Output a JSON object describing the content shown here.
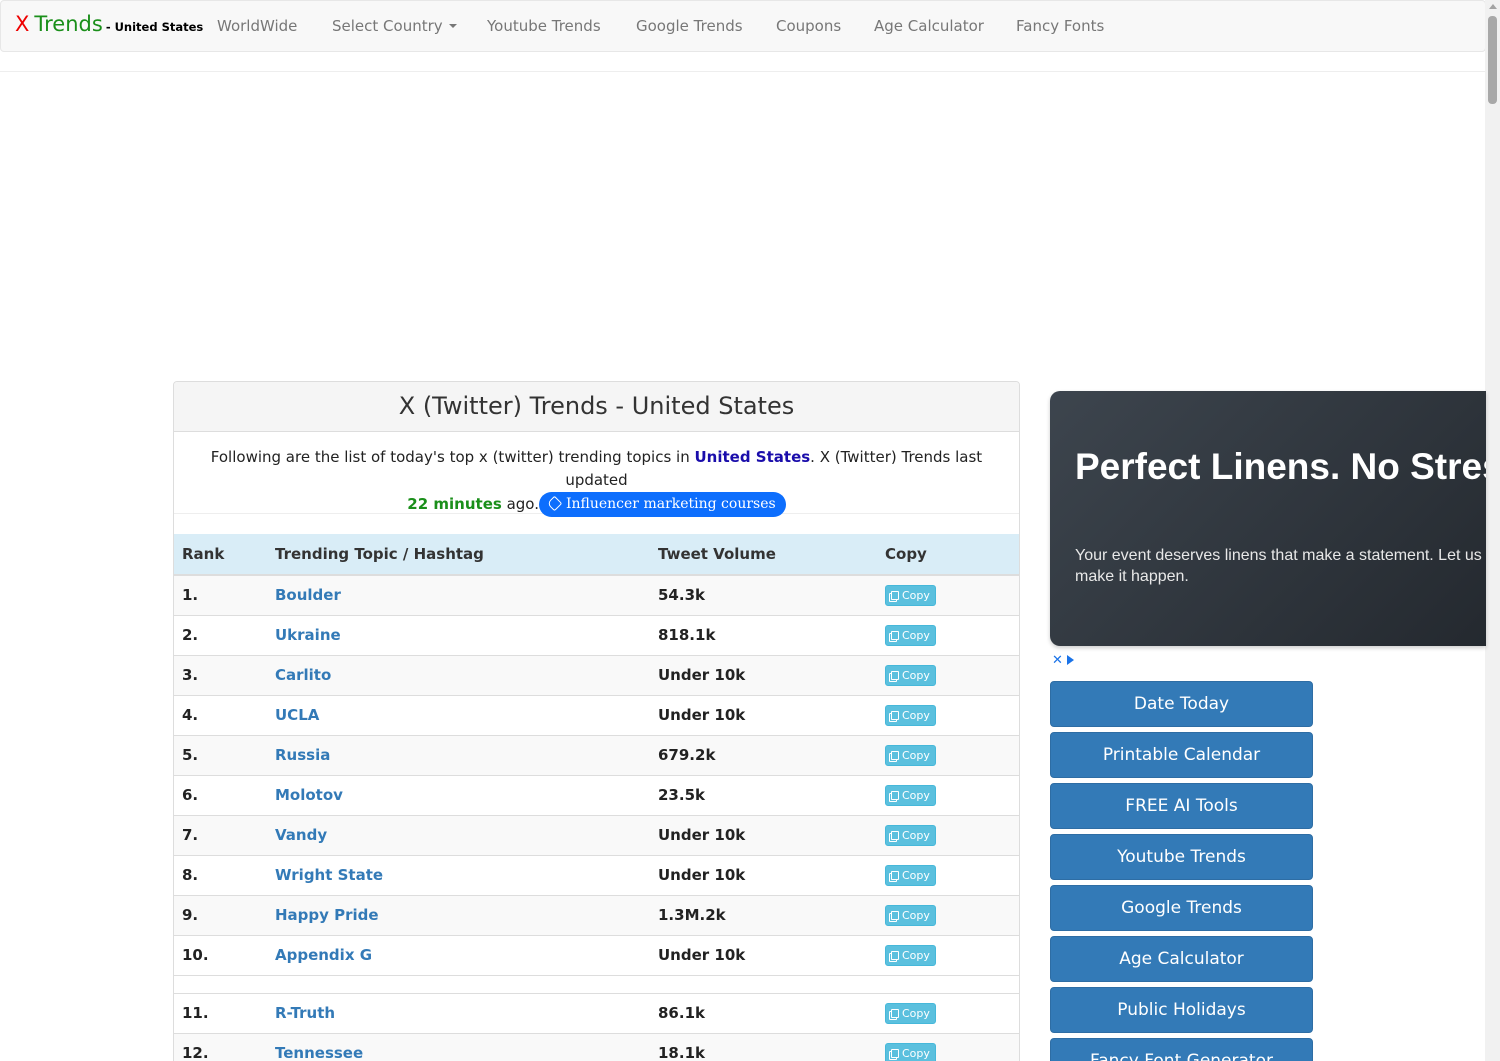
{
  "navbar": {
    "brand_x": "X",
    "brand_trends": "Trends",
    "brand_country": "- United States",
    "items": [
      "WorldWide",
      "Select Country",
      "Youtube Trends",
      "Google Trends",
      "Coupons",
      "Age Calculator",
      "Fancy Fonts"
    ]
  },
  "panel": {
    "title": "X (Twitter) Trends - United States",
    "intro_before": "Following are the list of today's top x (twitter) trending topics in ",
    "intro_country": "United States",
    "intro_after": ". X (Twitter) Trends last updated",
    "updated_minutes": "22 minutes",
    "ago": " ago.",
    "promo_label": "Influencer marketing courses"
  },
  "table": {
    "headers": [
      "Rank",
      "Trending Topic / Hashtag",
      "Tweet Volume",
      "Copy"
    ],
    "copy_label": "Copy",
    "rows": [
      {
        "rank": "1.",
        "topic": "Boulder",
        "volume": "54.3k"
      },
      {
        "rank": "2.",
        "topic": "Ukraine",
        "volume": "818.1k"
      },
      {
        "rank": "3.",
        "topic": "Carlito",
        "volume": "Under 10k"
      },
      {
        "rank": "4.",
        "topic": "UCLA",
        "volume": "Under 10k"
      },
      {
        "rank": "5.",
        "topic": "Russia",
        "volume": "679.2k"
      },
      {
        "rank": "6.",
        "topic": "Molotov",
        "volume": "23.5k"
      },
      {
        "rank": "7.",
        "topic": "Vandy",
        "volume": "Under 10k"
      },
      {
        "rank": "8.",
        "topic": "Wright State",
        "volume": "Under 10k"
      },
      {
        "rank": "9.",
        "topic": "Happy Pride",
        "volume": "1.3M.2k"
      },
      {
        "rank": "10.",
        "topic": "Appendix G",
        "volume": "Under 10k"
      },
      {
        "rank": "11.",
        "topic": "R-Truth",
        "volume": "86.1k"
      },
      {
        "rank": "12.",
        "topic": "Tennessee",
        "volume": "18.1k"
      }
    ]
  },
  "ad": {
    "title": "Perfect Linens. No Stress.",
    "text": "Your event deserves linens that make a statement. Let us make it happen.",
    "choices_close": "✕"
  },
  "sidebar": {
    "buttons": [
      "Date Today",
      "Printable Calendar",
      "FREE AI Tools",
      "Youtube Trends",
      "Google Trends",
      "Age Calculator",
      "Public Holidays",
      "Fancy Font Generator"
    ]
  },
  "colors": {
    "brand_red": "#ee0000",
    "brand_green": "#1a8f1a",
    "link_blue": "#337ab7",
    "header_row": "#d9edf7",
    "copy_button": "#5bc0de",
    "sidebar_button": "#337ab7",
    "promo_pill": "#0d6efd"
  }
}
